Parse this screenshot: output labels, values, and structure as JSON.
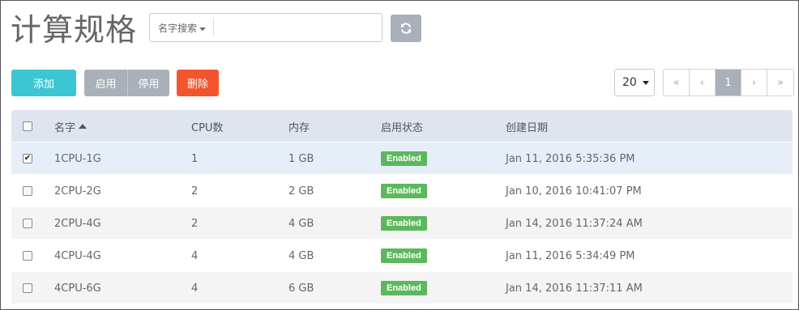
{
  "page": {
    "title": "计算规格"
  },
  "search": {
    "filter_label": "名字搜索",
    "value": "",
    "placeholder": ""
  },
  "toolbar": {
    "add_label": "添加",
    "enable_label": "启用",
    "disable_label": "停用",
    "delete_label": "删除",
    "refresh_icon": "refresh-icon"
  },
  "pagination": {
    "page_size": "20",
    "first": "«",
    "prev": "‹",
    "current": "1",
    "next": "›",
    "last": "»"
  },
  "table": {
    "headers": {
      "name": "名字",
      "cpu": "CPU数",
      "memory": "内存",
      "status": "启用状态",
      "created": "创建日期"
    },
    "rows": [
      {
        "name": "1CPU-1G",
        "cpu": "1",
        "memory": "1 GB",
        "status": "Enabled",
        "created": "Jan 11, 2016 5:35:36 PM",
        "checked": true
      },
      {
        "name": "2CPU-2G",
        "cpu": "2",
        "memory": "2 GB",
        "status": "Enabled",
        "created": "Jan 10, 2016 10:41:07 PM",
        "checked": false
      },
      {
        "name": "2CPU-4G",
        "cpu": "2",
        "memory": "4 GB",
        "status": "Enabled",
        "created": "Jan 14, 2016 11:37:24 AM",
        "checked": false
      },
      {
        "name": "4CPU-4G",
        "cpu": "4",
        "memory": "4 GB",
        "status": "Enabled",
        "created": "Jan 11, 2016 5:34:49 PM",
        "checked": false
      },
      {
        "name": "4CPU-6G",
        "cpu": "4",
        "memory": "6 GB",
        "status": "Enabled",
        "created": "Jan 14, 2016 11:37:11 AM",
        "checked": false
      }
    ]
  },
  "colors": {
    "primary": "#3cc6d3",
    "danger": "#f2552e",
    "neutral": "#a9b0ba",
    "success": "#5cb85c",
    "header_bg": "#dfe5ee"
  }
}
